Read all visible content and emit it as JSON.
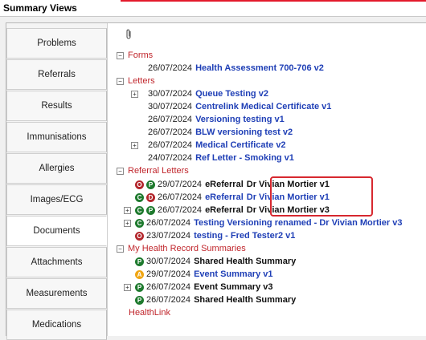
{
  "window": {
    "title": "Summary Views"
  },
  "sidebar": {
    "items": [
      {
        "label": "Problems",
        "active": false
      },
      {
        "label": "Referrals",
        "active": false
      },
      {
        "label": "Results",
        "active": false
      },
      {
        "label": "Immunisations",
        "active": false
      },
      {
        "label": "Allergies",
        "active": false
      },
      {
        "label": "Images/ECG",
        "active": false
      },
      {
        "label": "Documents",
        "active": true
      },
      {
        "label": "Attachments",
        "active": false
      },
      {
        "label": "Measurements",
        "active": false
      },
      {
        "label": "Medications",
        "active": false
      }
    ]
  },
  "colors": {
    "accent_red": "#e3192b",
    "link_blue": "#1f3fb6",
    "group_red": "#c0262c",
    "status_green": "#1e7a2e",
    "status_red": "#b3262c",
    "status_amber": "#f0a614"
  },
  "toolbar": {
    "attach_icon": "paperclip-icon"
  },
  "tree": {
    "forms": {
      "label": "Forms",
      "items": [
        {
          "date": "26/07/2024",
          "title": "Health Assessment 700-706 v2"
        }
      ]
    },
    "letters": {
      "label": "Letters",
      "items": [
        {
          "date": "30/07/2024",
          "title": "Queue Testing v2",
          "expandable": true
        },
        {
          "date": "30/07/2024",
          "title": "Centrelink Medical Certificate v1"
        },
        {
          "date": "26/07/2024",
          "title": "Versioning testing v1"
        },
        {
          "date": "26/07/2024",
          "title": "BLW versioning test v2"
        },
        {
          "date": "26/07/2024",
          "title": "Medical Certificate v2",
          "expandable": true
        },
        {
          "date": "24/07/2024",
          "title": "Ref Letter - Smoking v1"
        }
      ]
    },
    "referral_letters": {
      "label": "Referral Letters",
      "items": [
        {
          "icons": [
            "O",
            "P"
          ],
          "date": "29/07/2024",
          "source": "eReferral",
          "title": "Dr Vivian Mortier v1"
        },
        {
          "icons": [
            "C",
            "D"
          ],
          "date": "26/07/2024",
          "source": "eReferral",
          "title": "Dr Vivian Mortier v1"
        },
        {
          "icons": [
            "C",
            "P"
          ],
          "date": "26/07/2024",
          "source": "eReferral",
          "title": "Dr Vivian Mortier v3",
          "expandable": true
        },
        {
          "icons": [
            "C"
          ],
          "date": "26/07/2024",
          "title": "Testing Versioning renamed - Dr Vivian Mortier v3",
          "expandable": true
        },
        {
          "icons": [
            "O"
          ],
          "date": "23/07/2024",
          "title": "testing - Fred Tester2 v1"
        }
      ]
    },
    "mhr": {
      "label": "My Health Record Summaries",
      "items": [
        {
          "icons": [
            "P"
          ],
          "date": "30/07/2024",
          "title": "Shared Health Summary"
        },
        {
          "icons": [
            "A"
          ],
          "date": "29/07/2024",
          "title": "Event Summary v1"
        },
        {
          "icons": [
            "P"
          ],
          "date": "26/07/2024",
          "title": "Event Summary v3",
          "expandable": true
        },
        {
          "icons": [
            "P"
          ],
          "date": "26/07/2024",
          "title": "Shared Health Summary"
        }
      ]
    },
    "healthlink": {
      "label": "HealthLink"
    }
  }
}
